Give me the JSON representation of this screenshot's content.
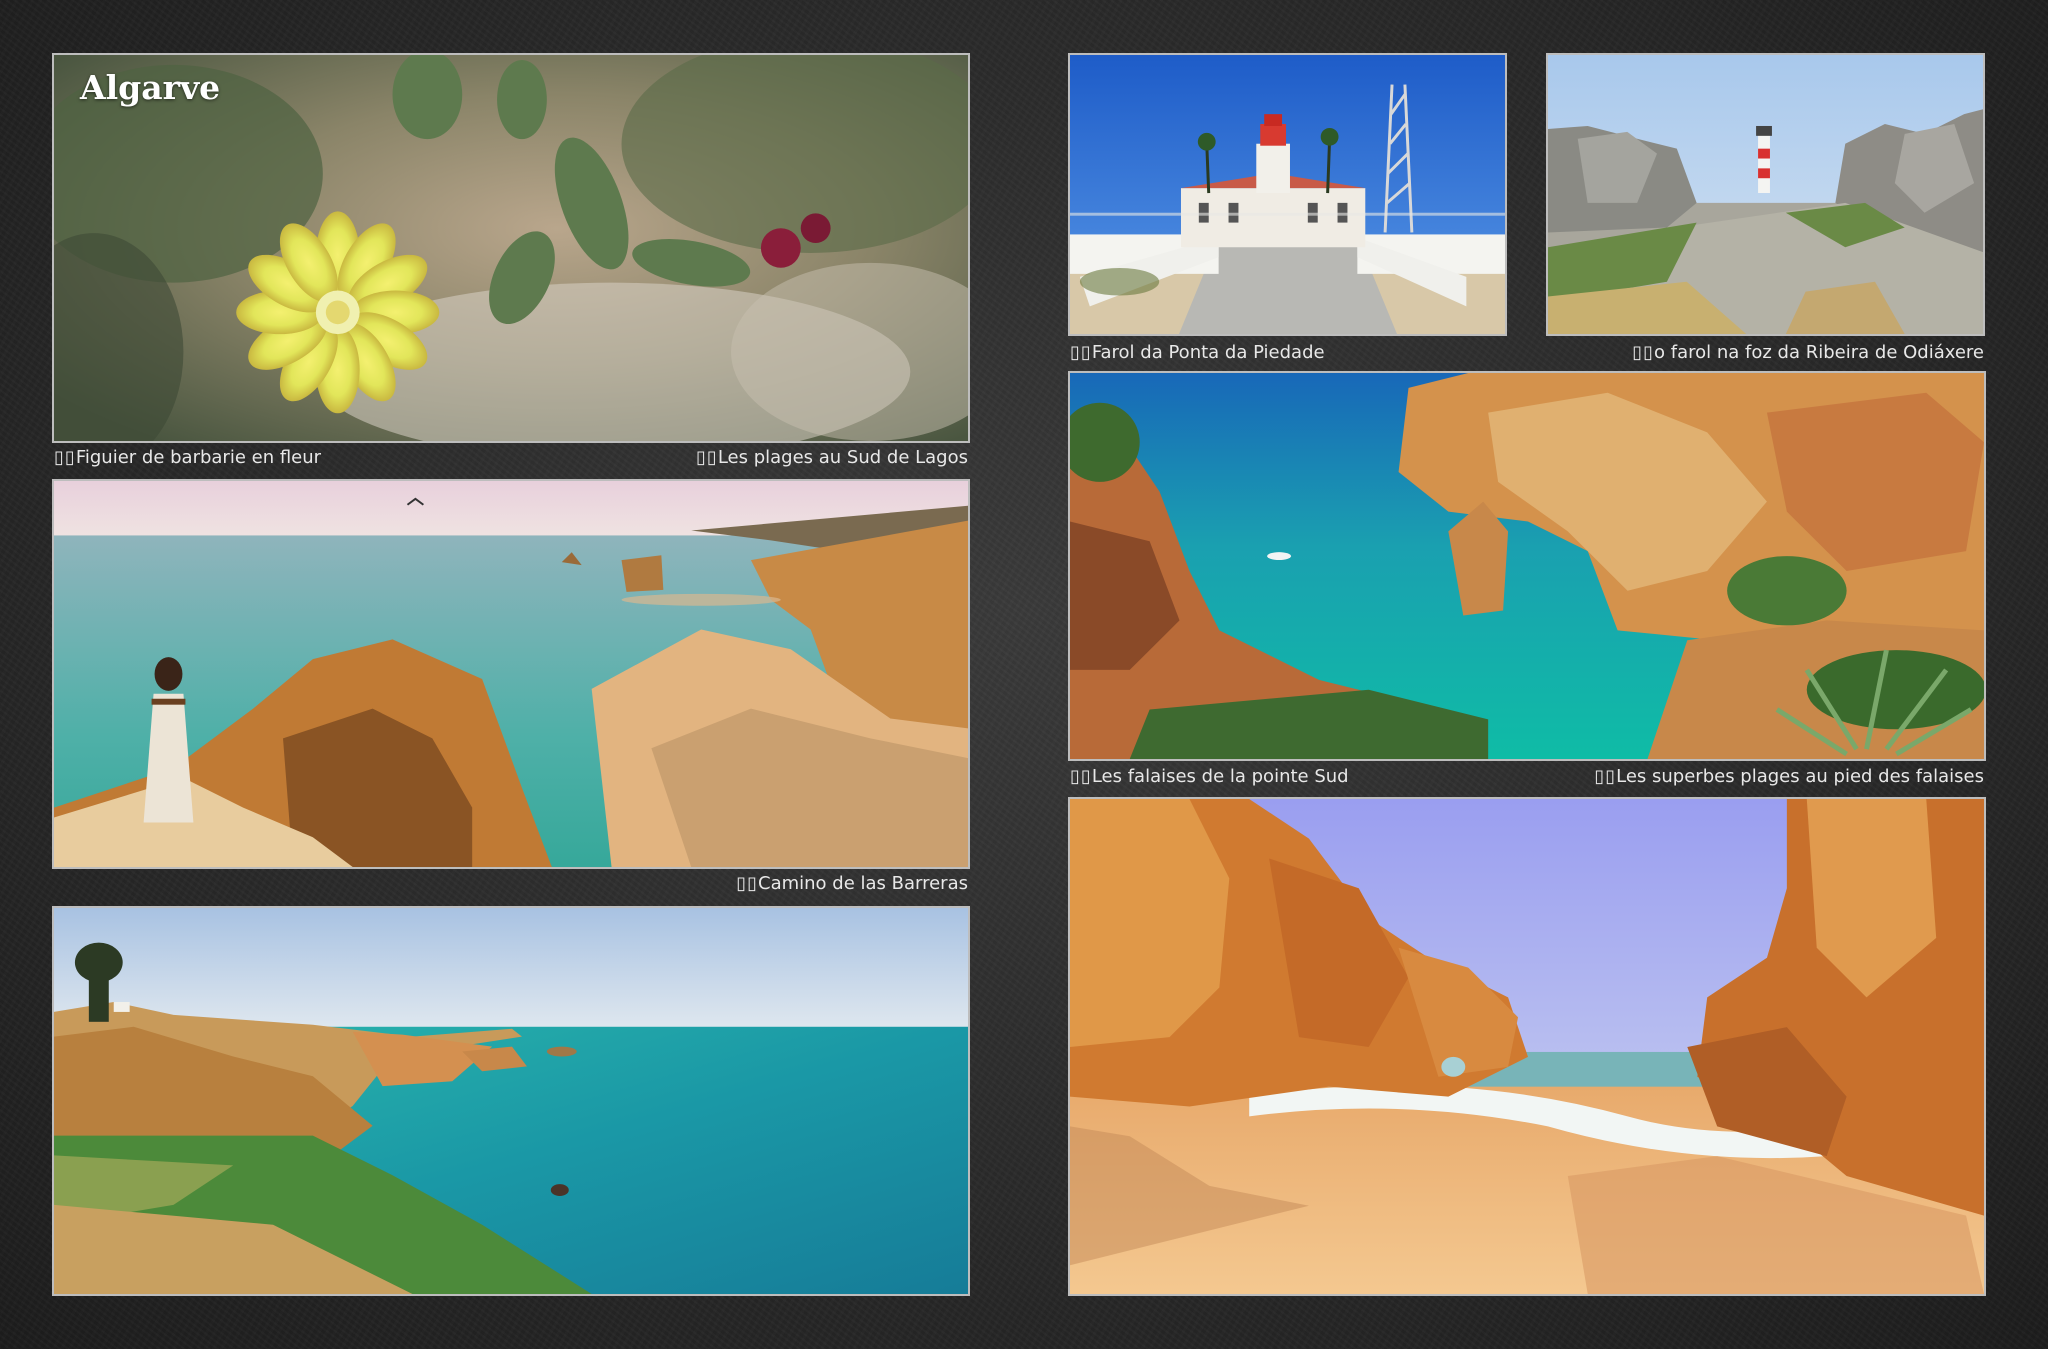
{
  "page": {
    "title": "Algarve",
    "caption_marker": "▯▯"
  },
  "captions": {
    "figuier": "Figuier de barbarie en fleur",
    "plages_lagos": "Les plages au Sud de Lagos",
    "camino": "Camino de las Barreras",
    "farol_piedade": "Farol da Ponta da Piedade",
    "farol_foz": "o farol na foz da Ribeira de Odiáxere",
    "falaises": "Les falaises de la pointe Sud",
    "superbes": "Les superbes plages au pied des falaises"
  },
  "colors": {
    "background": "#2a2a2a",
    "frame": "#bdbdbd",
    "caption": "#e8e8e8",
    "sea": "#1fa6a0",
    "sand": "#e0a060",
    "cliff": "#c8782e",
    "sky": "#3c7fd8"
  }
}
